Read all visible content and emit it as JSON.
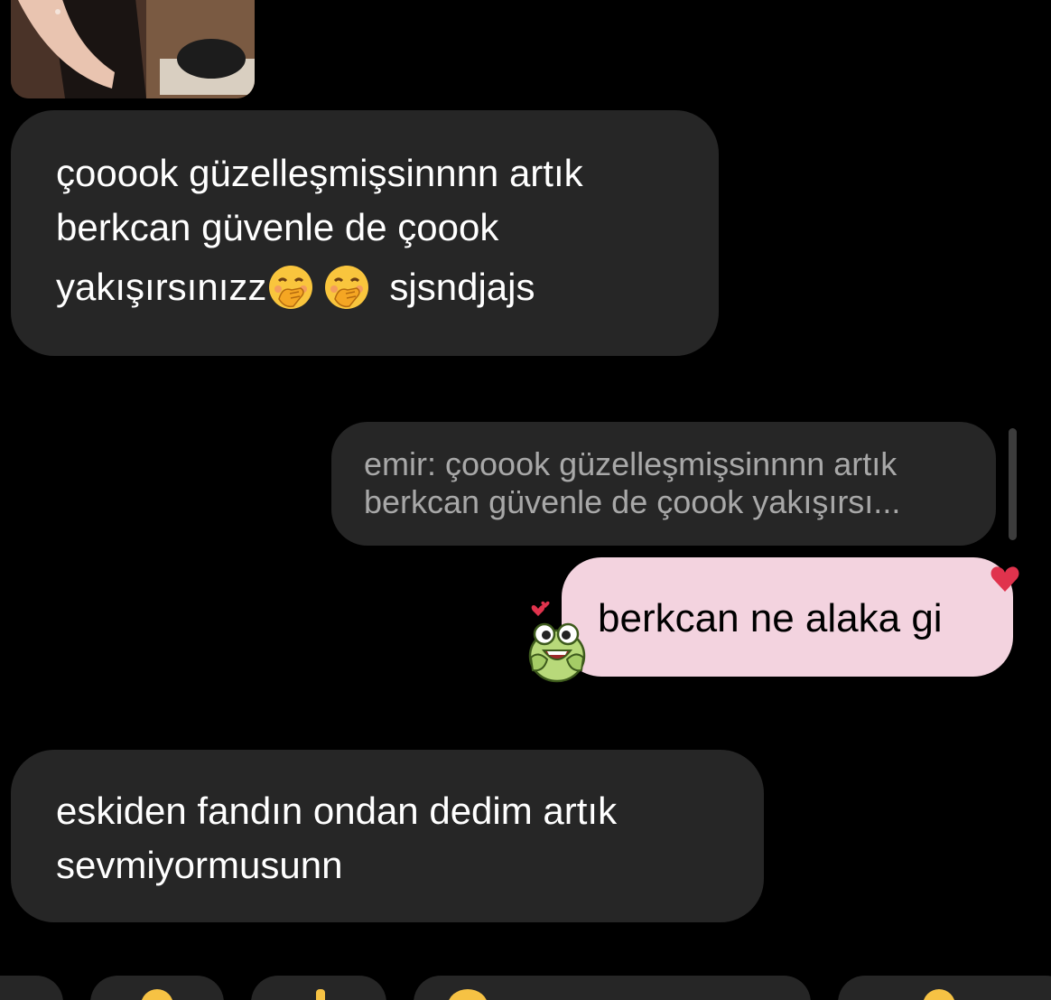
{
  "photo_message": {
    "icon": "photo-thumbnail"
  },
  "messages": [
    {
      "id": "msg1",
      "direction": "incoming",
      "lines": [
        "çooook güzelleşmişsinnnn artık",
        "berkcan güvenle de çoook",
        "yakışırsınızz",
        "sjsndjajs"
      ],
      "emoji": [
        "hand-over-mouth-emoji",
        "hand-over-mouth-emoji"
      ]
    },
    {
      "id": "msg2",
      "direction": "outgoing",
      "reply_to": {
        "lines": [
          "emir: çooook güzelleşmişsinnnn artık",
          "berkcan güvenle de çoook yakışırsı..."
        ]
      },
      "text": "berkcan ne alaka gi",
      "reaction_icon": "heart-icon",
      "sticker": "frog-sticker"
    },
    {
      "id": "msg3",
      "direction": "incoming",
      "lines": [
        "eskiden fandın ondan dedim artık",
        "sevmiyormusunn"
      ]
    }
  ],
  "colors": {
    "background": "#000000",
    "incoming_bubble": "#262626",
    "outgoing_bubble": "#f3d3df",
    "quote_text": "#a8a8a8",
    "heart": "#e0334d"
  }
}
